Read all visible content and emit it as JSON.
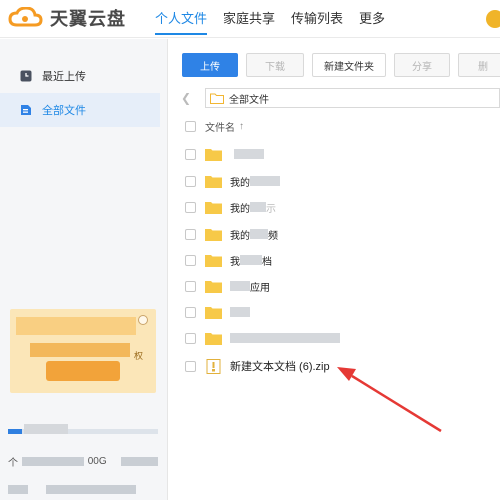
{
  "header": {
    "logo_text": "天翼云盘",
    "nav": [
      "个人文件",
      "家庭共享",
      "传输列表",
      "更多"
    ],
    "brand_color": "#1e88e5"
  },
  "sidebar": {
    "items": [
      {
        "label": "最近上传",
        "icon": "clock-icon"
      },
      {
        "label": "全部文件",
        "icon": "file-icon"
      }
    ],
    "promo_partial_text": "权",
    "storage_prefix": "个",
    "storage_suffix": "00G"
  },
  "toolbar": {
    "upload": "上传",
    "download": "下载",
    "new_folder": "新建文件夹",
    "share": "分享",
    "delete": "删"
  },
  "path": {
    "current": "全部文件",
    "back_icon": "back-arrow-icon"
  },
  "list": {
    "column_name": "文件名",
    "sort_indicator": "↑",
    "rows": [
      {
        "type": "folder",
        "visible_text": ""
      },
      {
        "type": "folder",
        "visible_text": "我的"
      },
      {
        "type": "folder",
        "visible_text": "我的"
      },
      {
        "type": "folder",
        "visible_text": "我的"
      },
      {
        "type": "folder",
        "visible_text": "我"
      },
      {
        "type": "folder",
        "visible_text": ""
      },
      {
        "type": "folder",
        "visible_text": ""
      },
      {
        "type": "folder",
        "visible_text": ""
      },
      {
        "type": "zip",
        "visible_text": "新建文本文档 (6).zip"
      }
    ],
    "row3_tail": "示",
    "row4_tail": "频",
    "row5_tail": "档",
    "row6_tail": "应用"
  },
  "colors": {
    "primary": "#2f82e6",
    "folder": "#f7c948",
    "annotation_arrow": "#e53935"
  }
}
